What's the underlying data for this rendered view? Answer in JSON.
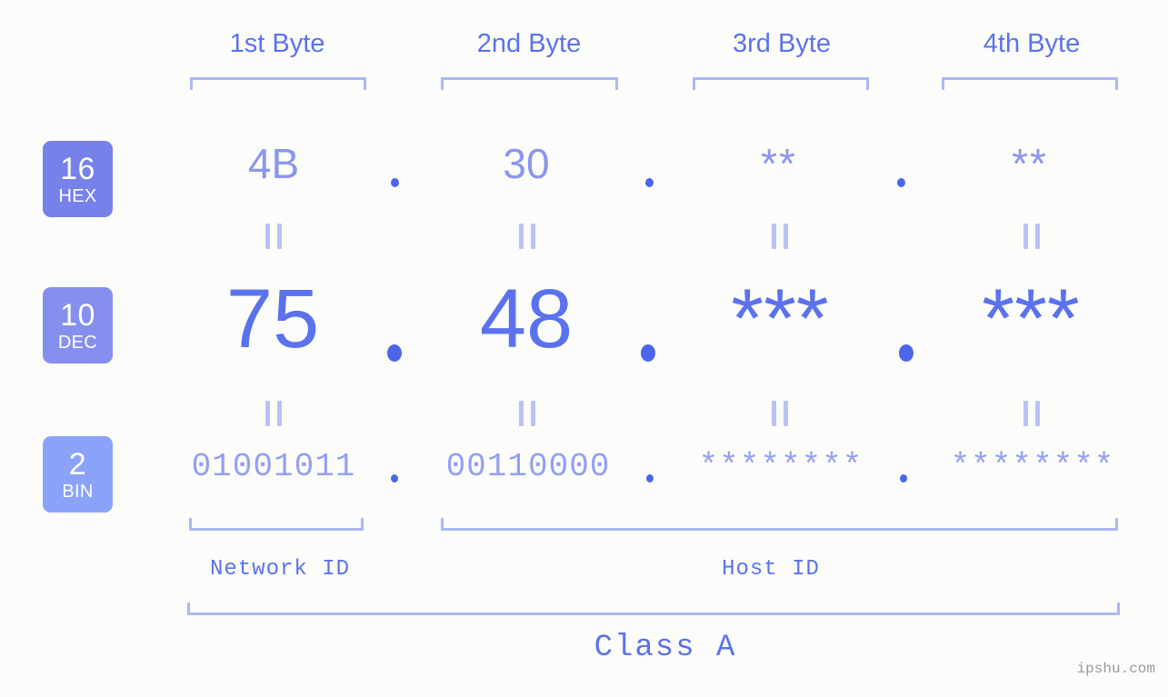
{
  "background_color": "#fcfdfa",
  "accent_colors": {
    "strong_blue": "#5b72ee",
    "mid_blue": "#8b96ef",
    "light_blue": "#adb8f4",
    "badge_hex": "#7681ea",
    "badge_dec": "#8590ee",
    "badge_bin": "#8ba2f9",
    "dot": "#4b66e8",
    "watermark": "#9a9a9a"
  },
  "header": {
    "byte_labels": [
      "1st Byte",
      "2nd Byte",
      "3rd Byte",
      "4th Byte"
    ]
  },
  "radix_badges": [
    {
      "number": "16",
      "name": "HEX"
    },
    {
      "number": "10",
      "name": "DEC"
    },
    {
      "number": "2",
      "name": "BIN"
    }
  ],
  "rows": {
    "hex": {
      "radix": "16",
      "radix_name": "HEX",
      "values": [
        "4B",
        "30",
        "**",
        "**"
      ],
      "separator": "."
    },
    "dec": {
      "radix": "10",
      "radix_name": "DEC",
      "values": [
        "75",
        "48",
        "***",
        "***"
      ],
      "separator": "."
    },
    "bin": {
      "radix": "2",
      "radix_name": "BIN",
      "values": [
        "01001011",
        "00110000",
        "********",
        "********"
      ],
      "separator": "."
    }
  },
  "equals_marker": "||",
  "groups": {
    "network_id_label": "Network ID",
    "host_id_label": "Host ID"
  },
  "class_label": "Class A",
  "watermark": "ipshu.com"
}
